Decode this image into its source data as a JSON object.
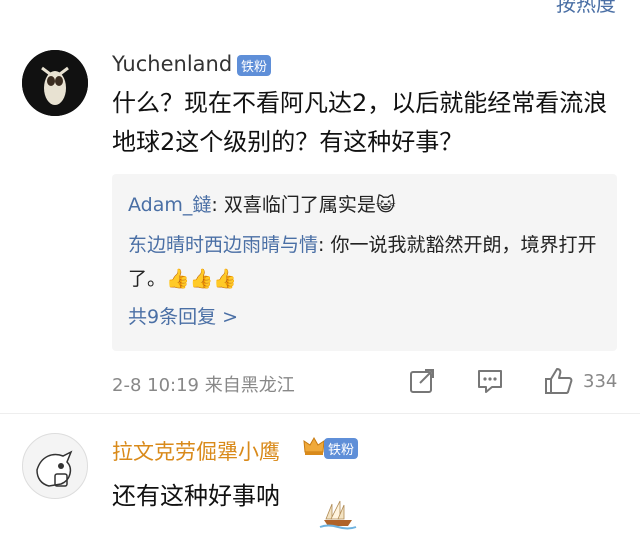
{
  "top_partial": "按热度",
  "comments": [
    {
      "username": "Yuchenland",
      "badge": "铁粉",
      "text": "什么？现在不看阿凡达2，以后就能经常看流浪地球2这个级别的？有这种好事？",
      "replies": [
        {
          "name": "Adam_鐽",
          "text": ": 双喜临门了属实是😺"
        },
        {
          "name": "东边晴时西边雨晴与情",
          "text": ": 你一说我就豁然开朗，境界打开了。👍👍👍"
        }
      ],
      "more_replies": "共9条回复 >",
      "meta": "2-8 10:19  来自黑龙江",
      "like_count": "334"
    },
    {
      "username": "拉文克劳倔犟小鹰",
      "badge": "铁粉",
      "text": "还有这种好事呐"
    }
  ],
  "colors": {
    "link": "#4a6fa5",
    "badge": "#5f8fd8",
    "vip_name": "#d98a1a"
  }
}
